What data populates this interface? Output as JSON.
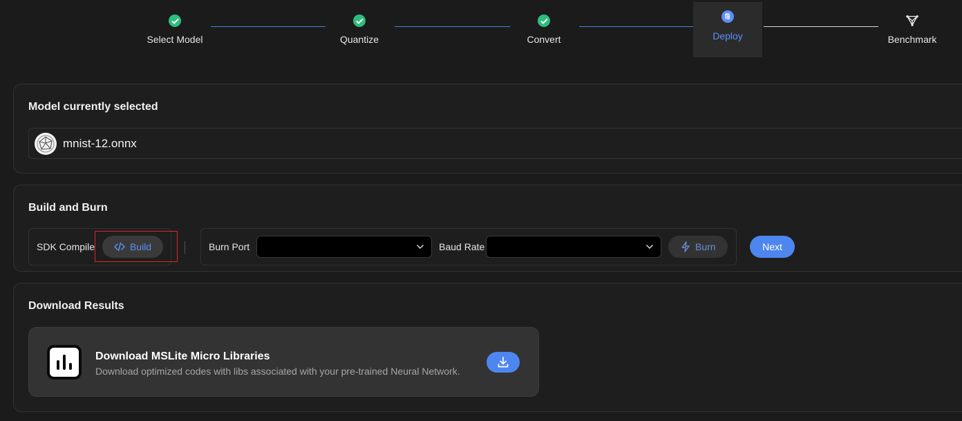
{
  "stepper": {
    "steps": [
      {
        "label": "Select Model",
        "state": "done",
        "icon": "check-circle-icon"
      },
      {
        "label": "Quantize",
        "state": "done",
        "icon": "check-circle-icon"
      },
      {
        "label": "Convert",
        "state": "done",
        "icon": "check-circle-icon"
      },
      {
        "label": "Deploy",
        "state": "active",
        "icon": "deploy-icon"
      },
      {
        "label": "Benchmark",
        "state": "pending",
        "icon": "benchmark-icon"
      }
    ]
  },
  "model_section": {
    "title": "Model currently selected",
    "model_name": "mnist-12.onnx",
    "model_icon": "onnx-logo-icon"
  },
  "build_section": {
    "title": "Build and Burn",
    "sdk_label": "SDK Compile",
    "build_label": "Build",
    "build_icon": "code-icon",
    "burn_port_label": "Burn Port",
    "burn_port_value": "",
    "baud_rate_label": "Baud Rate",
    "baud_rate_value": "",
    "burn_label": "Burn",
    "burn_icon": "lightning-icon",
    "next_label": "Next"
  },
  "download_section": {
    "title": "Download Results",
    "item_title": "Download MSLite Micro Libraries",
    "item_description": "Download optimized codes with libs associated with your pre-trained Neural Network.",
    "item_icon": "mslite-logo-icon",
    "download_icon": "download-icon"
  },
  "colors": {
    "accent": "#4e86f0",
    "success": "#2dbd7f",
    "highlight": "#e0242c",
    "background": "#1b1b1b"
  }
}
